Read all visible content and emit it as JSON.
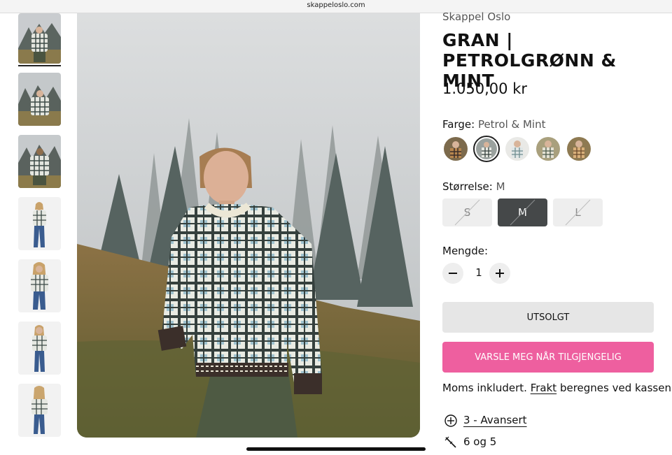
{
  "browser": {
    "url": "skappeloslo.com"
  },
  "product": {
    "vendor": "Skappel Oslo",
    "title": "GRAN | PETROLGRØNN & MINT",
    "price": "1.050,00 kr",
    "color_label": "Farge:",
    "color_value": "Petrol & Mint",
    "size_label": "Størrelse:",
    "size_value": "M",
    "sizes": [
      "S",
      "M",
      "L"
    ],
    "quantity_label": "Mengde:",
    "quantity_value": "1",
    "soldout_label": "UTSOLGT",
    "notify_label": "VARSLE MEG NÅR TILGJENGELIG",
    "tax_note_prefix": "Moms inkludert.",
    "tax_note_link": "Frakt",
    "tax_note_suffix": "beregnes ved kassen.",
    "features": [
      {
        "icon": "difficulty-icon",
        "text": "3 - Avansert"
      },
      {
        "icon": "knitting-needle-icon",
        "text": "6 og 5"
      }
    ]
  },
  "colors": {
    "accent_pink": "#ee5f9f",
    "selected_size_bg": "#454849",
    "button_gray": "#e6e6e6"
  }
}
